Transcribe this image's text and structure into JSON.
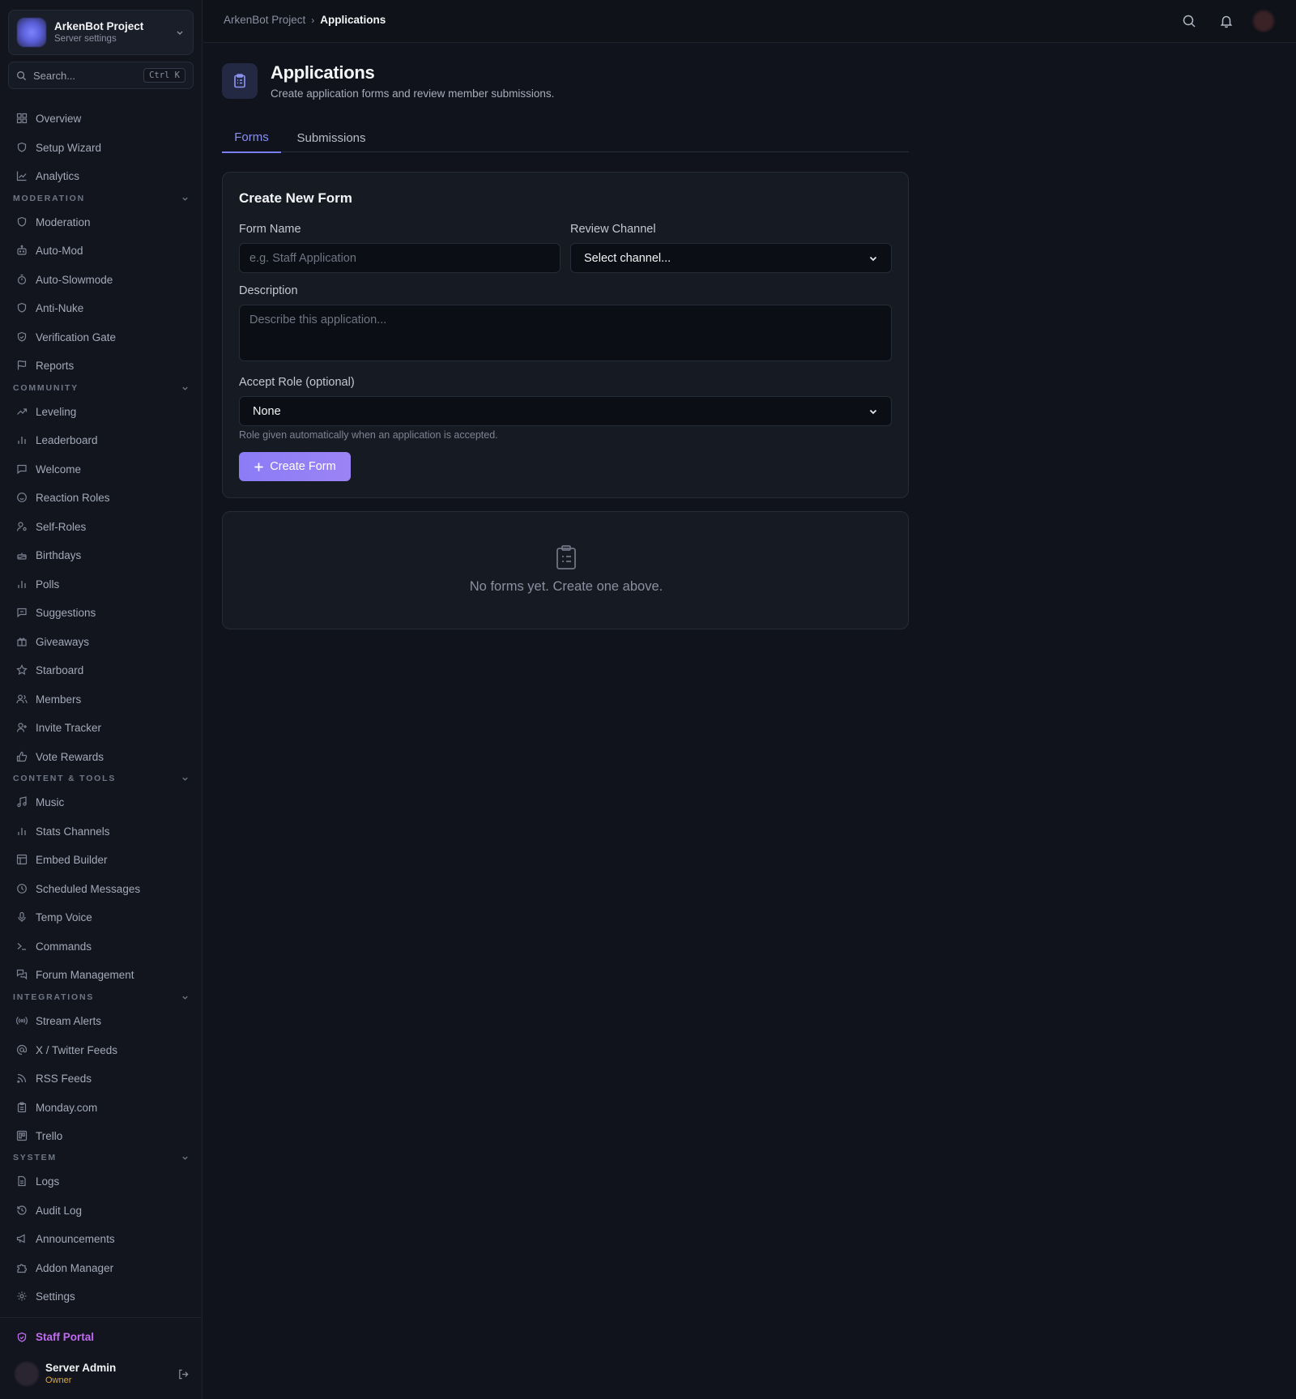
{
  "server": {
    "name": "ArkenBot Project",
    "subtitle": "Server settings"
  },
  "search": {
    "placeholder": "Search...",
    "shortcut": "Ctrl K"
  },
  "sidebar": {
    "top_items": [
      {
        "label": "Overview",
        "icon": "grid-icon"
      },
      {
        "label": "Setup Wizard",
        "icon": "shield-icon"
      },
      {
        "label": "Analytics",
        "icon": "chart-line-icon"
      }
    ],
    "sections": [
      {
        "title": "MODERATION",
        "items": [
          {
            "label": "Moderation",
            "icon": "shield-icon"
          },
          {
            "label": "Auto-Mod",
            "icon": "bot-icon"
          },
          {
            "label": "Auto-Slowmode",
            "icon": "timer-icon"
          },
          {
            "label": "Anti-Nuke",
            "icon": "shield-icon"
          },
          {
            "label": "Verification Gate",
            "icon": "shield-check-icon"
          },
          {
            "label": "Reports",
            "icon": "flag-icon"
          }
        ]
      },
      {
        "title": "COMMUNITY",
        "items": [
          {
            "label": "Leveling",
            "icon": "trending-up-icon"
          },
          {
            "label": "Leaderboard",
            "icon": "bar-chart-icon"
          },
          {
            "label": "Welcome",
            "icon": "message-icon"
          },
          {
            "label": "Reaction Roles",
            "icon": "smile-icon"
          },
          {
            "label": "Self-Roles",
            "icon": "user-cog-icon"
          },
          {
            "label": "Birthdays",
            "icon": "cake-icon"
          },
          {
            "label": "Polls",
            "icon": "bar-chart-icon"
          },
          {
            "label": "Suggestions",
            "icon": "message-square-icon"
          },
          {
            "label": "Giveaways",
            "icon": "gift-icon"
          },
          {
            "label": "Starboard",
            "icon": "star-icon"
          },
          {
            "label": "Members",
            "icon": "users-icon"
          },
          {
            "label": "Invite Tracker",
            "icon": "user-plus-icon"
          },
          {
            "label": "Vote Rewards",
            "icon": "thumbs-up-icon"
          }
        ]
      },
      {
        "title": "CONTENT & TOOLS",
        "items": [
          {
            "label": "Music",
            "icon": "music-icon"
          },
          {
            "label": "Stats Channels",
            "icon": "bar-chart-icon"
          },
          {
            "label": "Embed Builder",
            "icon": "layout-icon"
          },
          {
            "label": "Scheduled Messages",
            "icon": "clock-icon"
          },
          {
            "label": "Temp Voice",
            "icon": "mic-icon"
          },
          {
            "label": "Commands",
            "icon": "terminal-icon"
          },
          {
            "label": "Forum Management",
            "icon": "messages-icon"
          }
        ]
      },
      {
        "title": "INTEGRATIONS",
        "items": [
          {
            "label": "Stream Alerts",
            "icon": "radio-icon"
          },
          {
            "label": "X / Twitter Feeds",
            "icon": "at-sign-icon"
          },
          {
            "label": "RSS Feeds",
            "icon": "rss-icon"
          },
          {
            "label": "Monday.com",
            "icon": "clipboard-icon"
          },
          {
            "label": "Trello",
            "icon": "trello-icon"
          }
        ]
      },
      {
        "title": "SYSTEM",
        "items": [
          {
            "label": "Logs",
            "icon": "file-icon"
          },
          {
            "label": "Audit Log",
            "icon": "history-icon"
          },
          {
            "label": "Announcements",
            "icon": "megaphone-icon"
          },
          {
            "label": "Addon Manager",
            "icon": "puzzle-icon"
          },
          {
            "label": "Settings",
            "icon": "gear-icon"
          }
        ]
      }
    ],
    "staff_portal": "Staff Portal",
    "user": {
      "name": "Server Admin",
      "role": "Owner"
    }
  },
  "breadcrumb": {
    "parent": "ArkenBot Project",
    "separator": "›",
    "current": "Applications"
  },
  "page": {
    "title": "Applications",
    "subtitle": "Create application forms and review member submissions."
  },
  "tabs": [
    {
      "label": "Forms",
      "active": true
    },
    {
      "label": "Submissions",
      "active": false
    }
  ],
  "form": {
    "title": "Create New Form",
    "name_label": "Form Name",
    "name_placeholder": "e.g. Staff Application",
    "channel_label": "Review Channel",
    "channel_value": "Select channel...",
    "description_label": "Description",
    "description_placeholder": "Describe this application...",
    "role_label": "Accept Role (optional)",
    "role_value": "None",
    "role_hint": "Role given automatically when an application is accepted.",
    "create_button": "Create Form"
  },
  "empty_state": {
    "text": "No forms yet. Create one above."
  },
  "colors": {
    "accent": "#7b80f0",
    "staff": "#c06bf0",
    "owner": "#e2a72e",
    "background": "#10131b"
  }
}
